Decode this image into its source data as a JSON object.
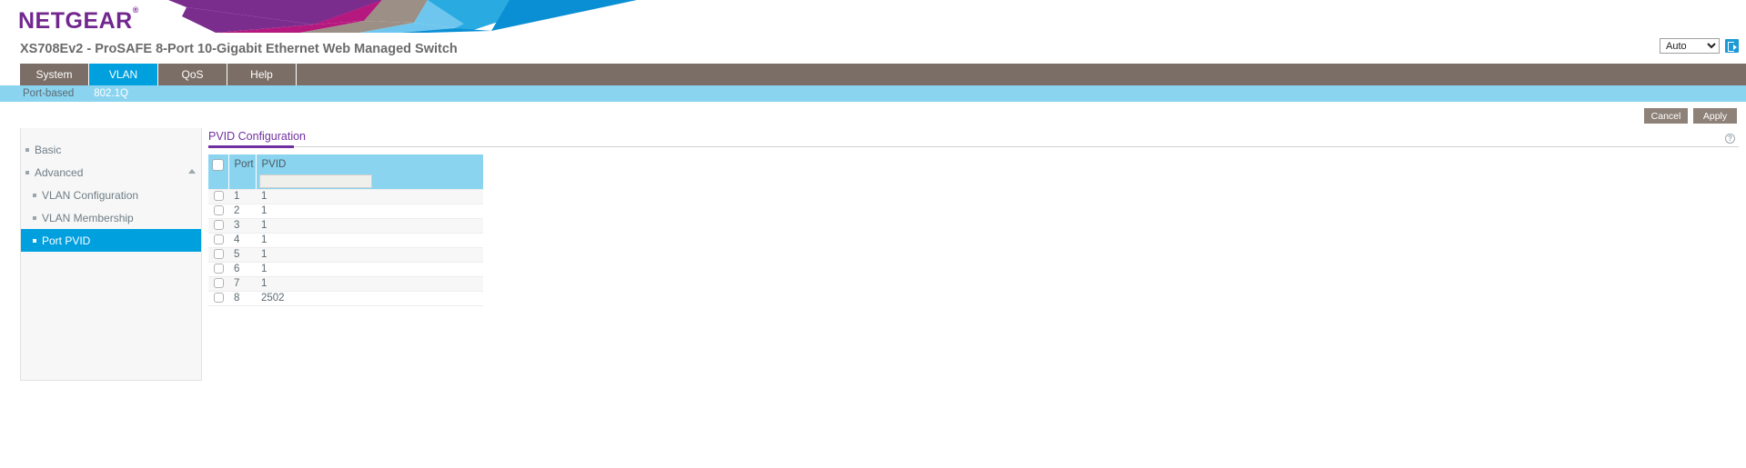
{
  "brand": {
    "name": "NETGEAR",
    "trademark": "®"
  },
  "device": {
    "title": "XS708Ev2 - ProSAFE 8-Port 10-Gigabit Ethernet Web Managed Switch"
  },
  "topbar": {
    "language_value": "Auto",
    "language_options": [
      "Auto"
    ],
    "logout_icon": "logout-icon"
  },
  "tabs": [
    {
      "label": "System",
      "active": false
    },
    {
      "label": "VLAN",
      "active": true
    },
    {
      "label": "QoS",
      "active": false
    },
    {
      "label": "Help",
      "active": false
    }
  ],
  "subnav": [
    {
      "label": "Port-based",
      "active": false
    },
    {
      "label": "802.1Q",
      "active": true
    }
  ],
  "actions": {
    "cancel_label": "Cancel",
    "apply_label": "Apply"
  },
  "sidebar": {
    "items": [
      {
        "label": "Basic",
        "level": 1,
        "active": false,
        "caret": false
      },
      {
        "label": "Advanced",
        "level": 1,
        "active": false,
        "caret": true
      },
      {
        "label": "VLAN Configuration",
        "level": 2,
        "active": false,
        "caret": false
      },
      {
        "label": "VLAN Membership",
        "level": 2,
        "active": false,
        "caret": false
      },
      {
        "label": "Port PVID",
        "level": 2,
        "active": true,
        "caret": false
      }
    ]
  },
  "panel": {
    "title": "PVID Configuration",
    "help_icon": "help-circle-icon"
  },
  "table": {
    "columns": [
      "",
      "Port",
      "PVID"
    ],
    "filter": {
      "pvid_value": "",
      "pvid_placeholder": ""
    },
    "rows": [
      {
        "port": "1",
        "pvid": "1"
      },
      {
        "port": "2",
        "pvid": "1"
      },
      {
        "port": "3",
        "pvid": "1"
      },
      {
        "port": "4",
        "pvid": "1"
      },
      {
        "port": "5",
        "pvid": "1"
      },
      {
        "port": "6",
        "pvid": "1"
      },
      {
        "port": "7",
        "pvid": "1"
      },
      {
        "port": "8",
        "pvid": "2502"
      }
    ]
  },
  "colors": {
    "brand_purple": "#72278f",
    "accent_blue": "#00a0df",
    "subnav_blue": "#8ad4f0",
    "tabbar_taupe": "#7b6e66",
    "title_purple": "#7030a0",
    "button_gray": "#8d8178"
  }
}
